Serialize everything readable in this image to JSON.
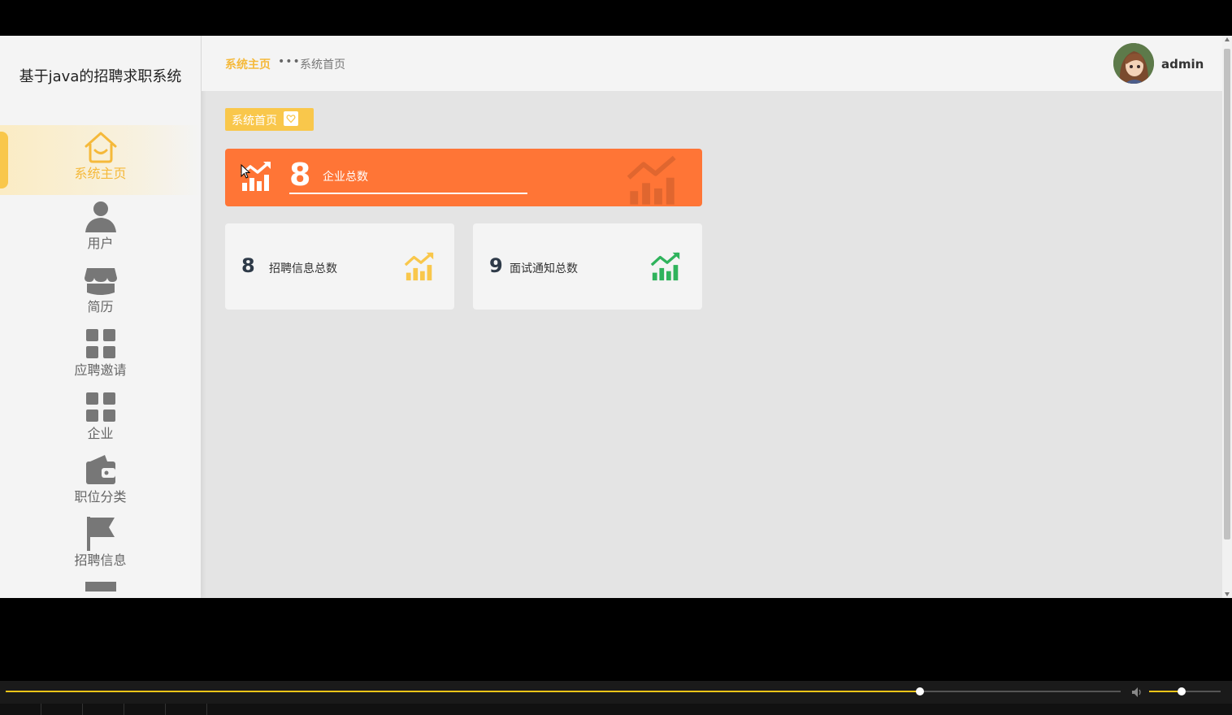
{
  "app": {
    "title": "基于java的招聘求职系统"
  },
  "sidebar": {
    "items": [
      {
        "label": "系统主页",
        "icon": "home-icon",
        "active": true
      },
      {
        "label": "用户",
        "icon": "user-icon"
      },
      {
        "label": "简历",
        "icon": "store-icon"
      },
      {
        "label": "应聘邀请",
        "icon": "grid-icon"
      },
      {
        "label": "企业",
        "icon": "grid-icon"
      },
      {
        "label": "职位分类",
        "icon": "wallet-icon"
      },
      {
        "label": "招聘信息",
        "icon": "flag-icon"
      }
    ]
  },
  "header": {
    "breadcrumb_main": "系统主页",
    "breadcrumb_sub": "系统首页",
    "username": "admin"
  },
  "page": {
    "tag_label": "系统首页"
  },
  "stats": {
    "main": {
      "value": "8",
      "label": "企业总数"
    },
    "cards": [
      {
        "value": "8",
        "label": "招聘信息总数",
        "icon_color": "#f9c74b"
      },
      {
        "value": "9",
        "label": "面试通知总数",
        "icon_color": "#2fb35c"
      }
    ]
  },
  "player": {
    "progress": 0.82,
    "volume": 0.45
  },
  "colors": {
    "accent": "#f9c74b",
    "orange": "#ff7536",
    "green": "#2fb35c"
  }
}
